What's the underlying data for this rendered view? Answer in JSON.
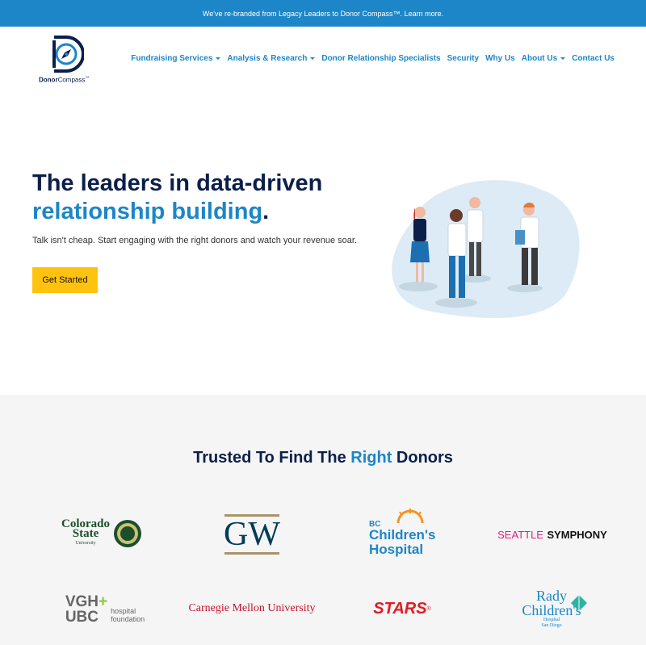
{
  "banner": {
    "text": "We've re-branded from Legacy Leaders to Donor Compass™.",
    "link": "Learn more."
  },
  "brand": {
    "name_bold": "Donor",
    "name_rest": "Compass",
    "tm": "™"
  },
  "nav": {
    "items": [
      {
        "label": "Fundraising Services",
        "dropdown": true
      },
      {
        "label": "Analysis & Research",
        "dropdown": true
      },
      {
        "label": "Donor Relationship Specialists",
        "dropdown": false
      },
      {
        "label": "Security",
        "dropdown": false
      },
      {
        "label": "Why Us",
        "dropdown": false
      },
      {
        "label": "About Us",
        "dropdown": true
      },
      {
        "label": "Contact Us",
        "dropdown": false
      }
    ]
  },
  "hero": {
    "title_line1": "The leaders in data-driven",
    "title_line2_blue": "relationship building",
    "title_line2_end": ".",
    "subtitle": "Talk isn't cheap. Start engaging with the right donors and watch your revenue soar.",
    "cta": "Get Started"
  },
  "trusted": {
    "title_start": "Trusted To Find The ",
    "title_blue": "Right",
    "title_end": " Donors",
    "logos": {
      "csu": {
        "line1": "Colorado",
        "line2": "State",
        "line3": "University"
      },
      "gw": {
        "text": "GW"
      },
      "bc": {
        "line0": "BC",
        "line1": "Children's",
        "line2": "Hospital"
      },
      "seattle": {
        "pink": "SEATTLE",
        "dark": "SYMPHONY"
      },
      "vgh": {
        "line1": "VGH",
        "line2": "UBC",
        "sub1": "hospital",
        "sub2": "foundation"
      },
      "cmu": {
        "text": "Carnegie Mellon University"
      },
      "stars": {
        "text": "STARS",
        "mark": "®"
      },
      "rady": {
        "line1": "Rady",
        "line2": "Children's",
        "sub1": "Hospital",
        "sub2": "San Diego"
      }
    }
  },
  "colors": {
    "brand_blue": "#1c86c8",
    "navy": "#0c1f4a",
    "cta_yellow": "#ffc20e",
    "section_gray": "#f5f5f5"
  }
}
